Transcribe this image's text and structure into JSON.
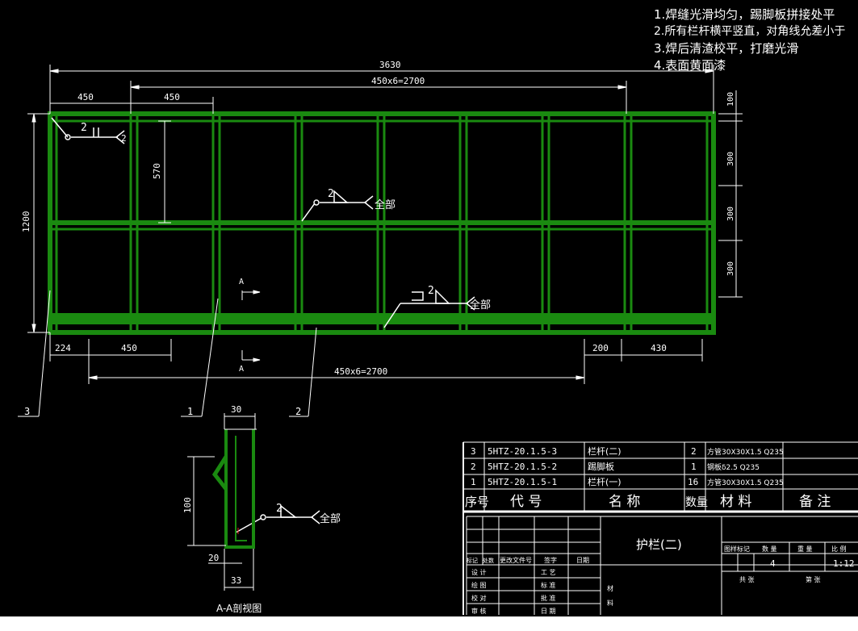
{
  "notes": {
    "line1": "1.焊缝光滑均匀，踢脚板拼接处平",
    "line2": "2.所有栏杆横平竖直，对角线允差小于",
    "line3": "3.焊后清渣校平，打磨光滑",
    "line4": "4.表面黄面漆"
  },
  "dims": {
    "overall_width": "3630",
    "spacing_top": "450x6=2700",
    "left_450_a": "450",
    "left_450_b": "450",
    "height_570": "570",
    "height_1200": "1200",
    "right_100_a": "100",
    "right_300_a": "300",
    "right_300_b": "300",
    "right_300_c": "300",
    "bottom_224": "224",
    "bottom_450": "450",
    "bottom_200": "200",
    "bottom_430": "430",
    "spacing_bottom": "450x6=2700"
  },
  "welds": {
    "w1_size": "2",
    "w1_size_b": "2",
    "w2_size": "2",
    "w2_label": "全部",
    "w3_size": "2",
    "w3_label": "全部",
    "w4_size": "2",
    "w4_label": "全部"
  },
  "section": {
    "mark_top": "A",
    "mark_bottom": "A",
    "width_30": "30",
    "height_100": "100",
    "bottom_20": "20",
    "bottom_33": "33",
    "caption": "A-A剖视图"
  },
  "callouts": {
    "c3": "3",
    "c1": "1",
    "c2": "2"
  },
  "bom": {
    "rows": [
      {
        "no": "3",
        "code": "5HTZ-20.1.5-3",
        "name": "栏杆(二)",
        "qty": "2",
        "material": "方管30X30X1.5 Q235"
      },
      {
        "no": "2",
        "code": "5HTZ-20.1.5-2",
        "name": "踢脚板",
        "qty": "1",
        "material": "钢板δ2.5 Q235"
      },
      {
        "no": "1",
        "code": "5HTZ-20.1.5-1",
        "name": "栏杆(一)",
        "qty": "16",
        "material": "方管30X30X1.5 Q235"
      }
    ],
    "header": {
      "no": "序号",
      "code": "代 号",
      "name": "名 称",
      "qty": "数量",
      "material": "材 料",
      "remark": "备 注"
    }
  },
  "title_block": {
    "drawing_name": "护栏(二)",
    "stage_mark": "图样标记",
    "qty_label": "数 量",
    "weight_label": "重 量",
    "scale_label": "比 例",
    "qty_value": "4",
    "scale_value": "1:12",
    "sheet_total": "共 张",
    "sheet_no": "第 张",
    "mark_label": "标记",
    "count_label": "处数",
    "doc_label": "更改文件号",
    "sign_label": "签字",
    "date_label": "日期",
    "design": "设 计",
    "drawing": "绘 图",
    "check": "校 对",
    "review": "审 核",
    "process": "工 艺",
    "standard": "标 准",
    "approve": "批 准",
    "date2": "日 期",
    "vertical_a": "材",
    "vertical_b": "料"
  }
}
